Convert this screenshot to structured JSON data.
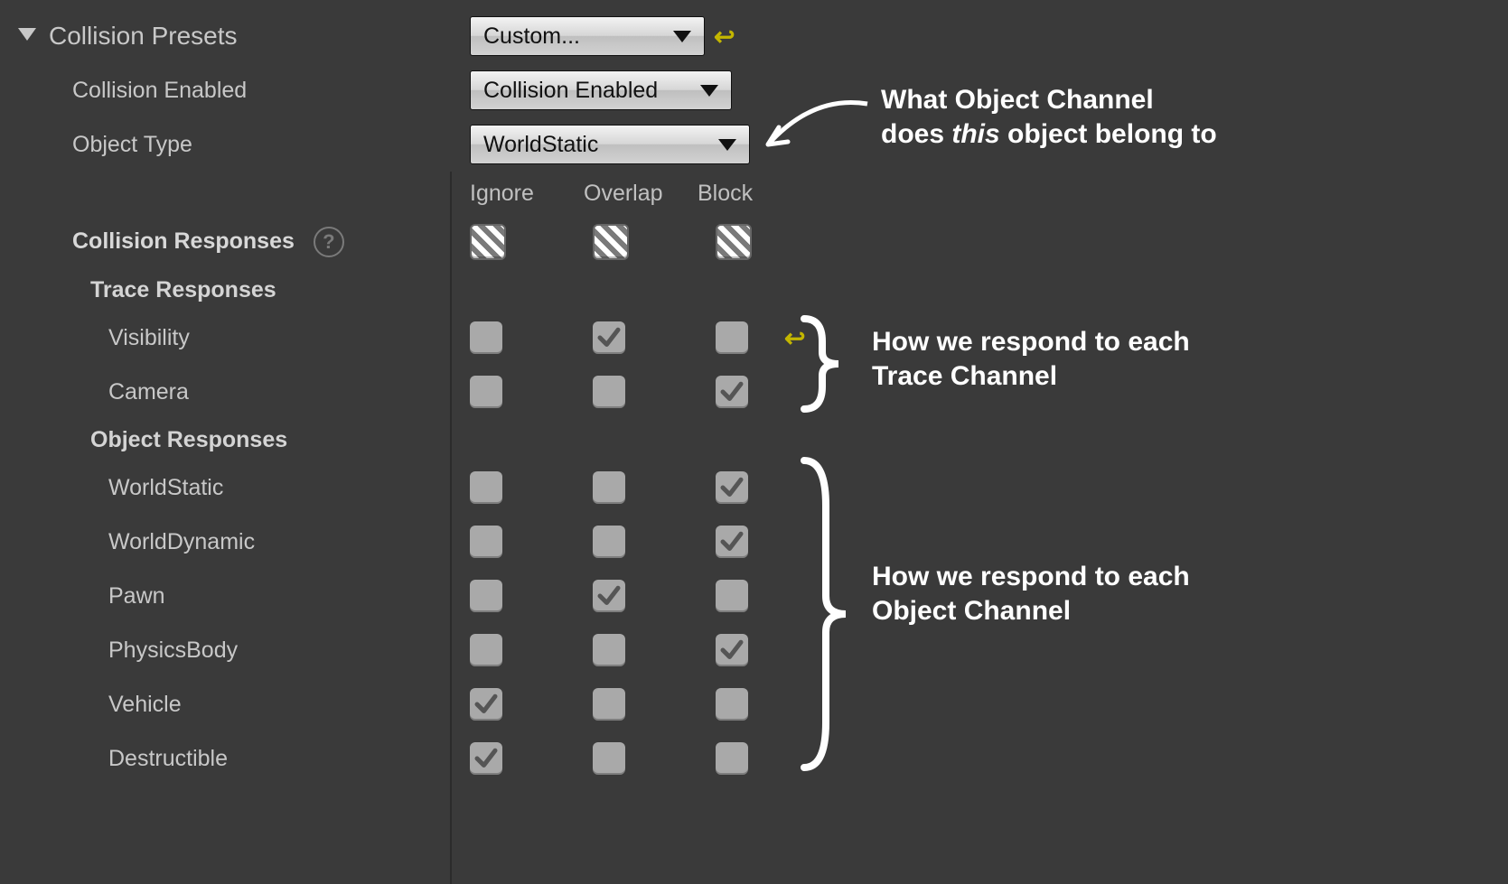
{
  "section": {
    "title": "Collision Presets"
  },
  "preset": {
    "label": "Custom...",
    "enabled_label": "Collision Enabled",
    "enabled_value": "Collision Enabled",
    "object_type_label": "Object Type",
    "object_type_value": "WorldStatic"
  },
  "responses": {
    "title": "Collision Responses",
    "columns": {
      "ignore": "Ignore",
      "overlap": "Overlap",
      "block": "Block"
    },
    "trace_title": "Trace Responses",
    "object_title": "Object Responses",
    "trace": [
      {
        "name": "Visibility",
        "ignore": false,
        "overlap": true,
        "block": false,
        "modified": true
      },
      {
        "name": "Camera",
        "ignore": false,
        "overlap": false,
        "block": true
      }
    ],
    "object": [
      {
        "name": "WorldStatic",
        "ignore": false,
        "overlap": false,
        "block": true
      },
      {
        "name": "WorldDynamic",
        "ignore": false,
        "overlap": false,
        "block": true
      },
      {
        "name": "Pawn",
        "ignore": false,
        "overlap": true,
        "block": false
      },
      {
        "name": "PhysicsBody",
        "ignore": false,
        "overlap": false,
        "block": true
      },
      {
        "name": "Vehicle",
        "ignore": true,
        "overlap": false,
        "block": false
      },
      {
        "name": "Destructible",
        "ignore": true,
        "overlap": false,
        "block": false
      }
    ]
  },
  "annotations": {
    "a1a": "What Object Channel",
    "a1b_pre": "does ",
    "a1b_it": "this",
    "a1b_post": " object belong to",
    "a2a": "How we respond to each",
    "a2b": "Trace Channel",
    "a3a": "How we respond to each",
    "a3b": "Object Channel"
  },
  "icons": {
    "revert": "↩",
    "help": "?"
  }
}
